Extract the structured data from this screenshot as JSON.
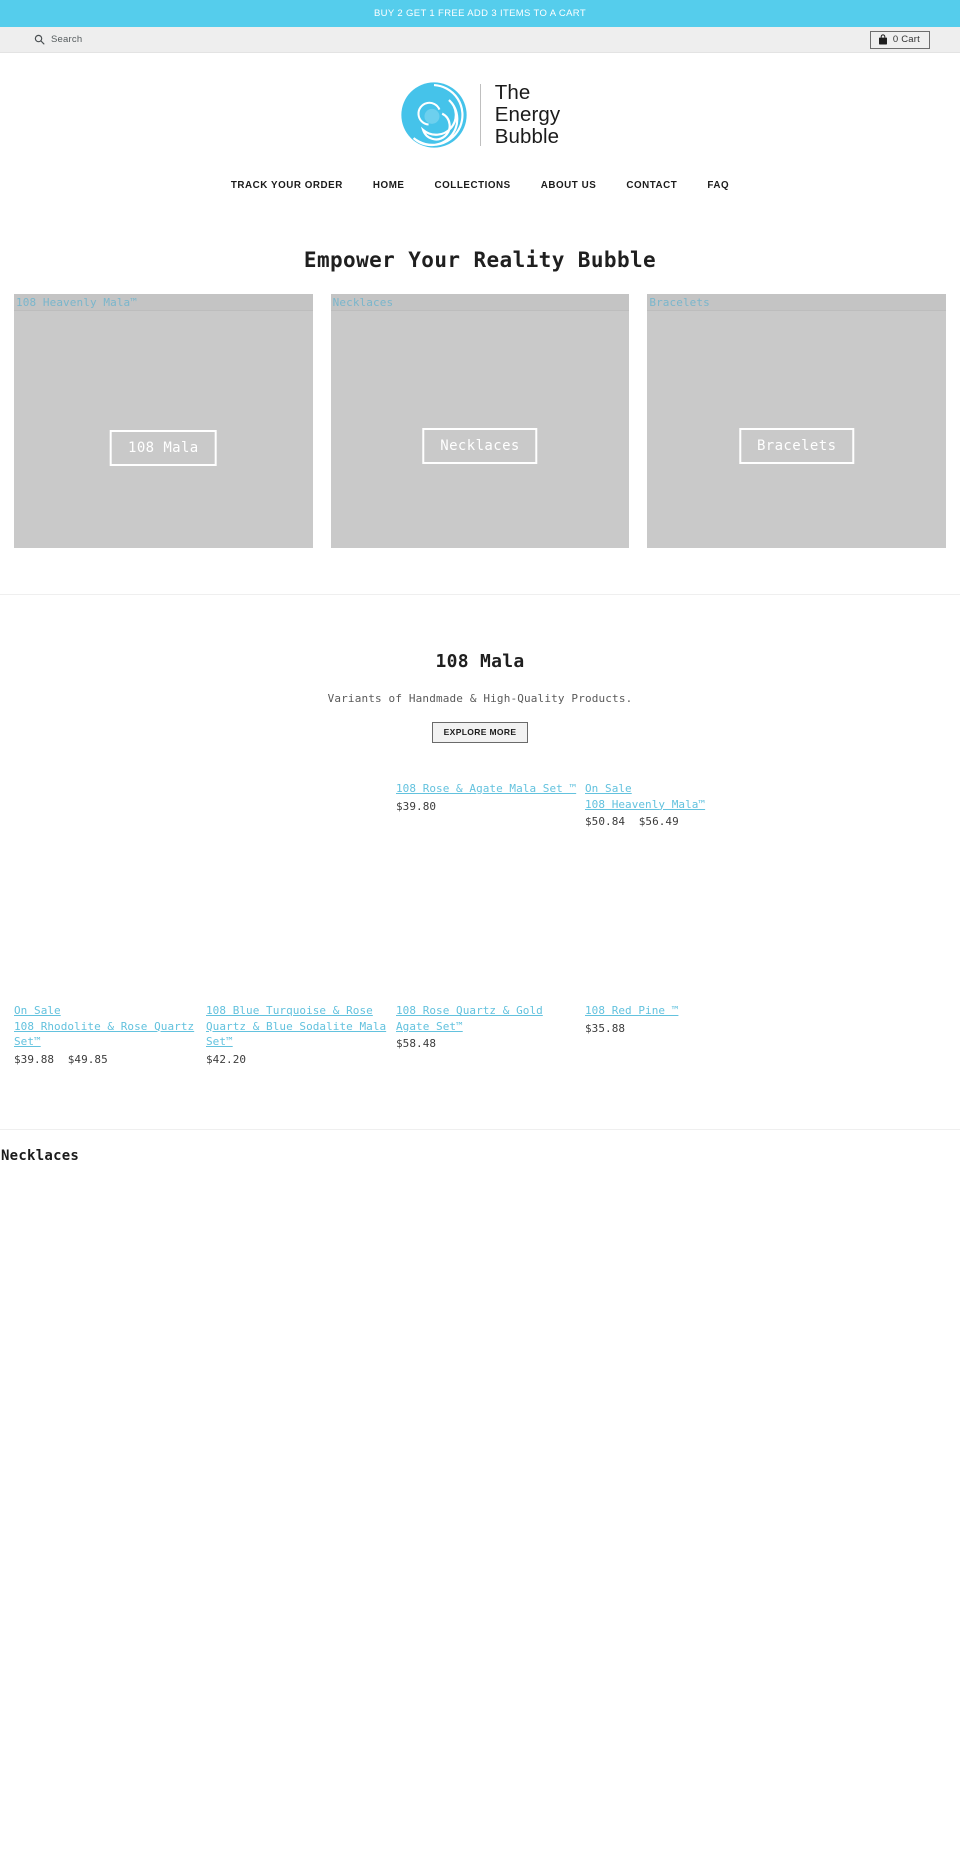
{
  "announcement": {
    "text": "BUY 2 GET 1 FREE ADD 3 ITEMS TO A CART"
  },
  "utilbar": {
    "search_label": "Search",
    "search_icon": "search-icon",
    "cart_label": "0 Cart",
    "cart_icon": "shopping-bag-icon"
  },
  "brand": {
    "line1": "The",
    "line2": "Energy",
    "line3": "Bubble",
    "logo_icon": "bubble-spiral-logo",
    "accent_color": "#55cdec"
  },
  "nav": {
    "items": [
      {
        "label": "TRACK YOUR ORDER"
      },
      {
        "label": "HOME"
      },
      {
        "label": "COLLECTIONS"
      },
      {
        "label": "ABOUT US"
      },
      {
        "label": "CONTACT"
      },
      {
        "label": "FAQ"
      }
    ]
  },
  "hero": {
    "heading": "Empower Your Reality Bubble"
  },
  "categories": [
    {
      "alt": "108 Heavenly Mala™",
      "button": "108 Mala"
    },
    {
      "alt": "Necklaces",
      "button": "Necklaces"
    },
    {
      "alt": "Bracelets",
      "button": "Bracelets"
    }
  ],
  "collection": {
    "title": "108 Mala",
    "subtitle": "Variants of Handmade & High-Quality Products.",
    "button": "EXPLORE MORE"
  },
  "products_top": [
    {
      "sale": "",
      "name": "108 Rose & Agate Mala Set ™",
      "price": "$39.80",
      "compare": ""
    },
    {
      "sale": "On Sale",
      "name": "108 Heavenly Mala™",
      "price": "$50.84",
      "compare": "$56.49"
    }
  ],
  "products_bottom": [
    {
      "sale": "On Sale",
      "name": "108 Rhodolite & Rose Quartz Set™",
      "price": "$39.88",
      "compare": "$49.85"
    },
    {
      "sale": "",
      "name": "108 Blue Turquoise & Rose Quartz & Blue Sodalite Mala Set™",
      "price": "$42.20",
      "compare": ""
    },
    {
      "sale": "",
      "name": "108 Rose Quartz & Gold Agate Set™",
      "price": "$58.48",
      "compare": ""
    },
    {
      "sale": "",
      "name": "108 Red Pine ™",
      "price": "$35.88",
      "compare": ""
    }
  ],
  "next_section": {
    "title": "Necklaces"
  }
}
